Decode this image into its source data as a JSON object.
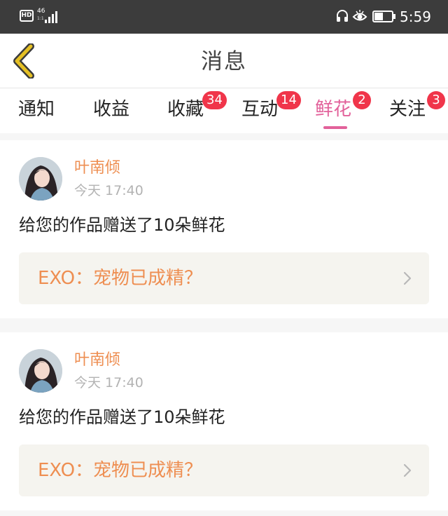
{
  "status_bar": {
    "hd": "HD",
    "network": "46",
    "network_sub": "1:1",
    "time": "5:59",
    "icons": [
      "hd-icon",
      "signal-icon",
      "headset-icon",
      "eye-icon",
      "battery-icon"
    ],
    "battery_level": 0.5
  },
  "header": {
    "title": "消息",
    "back_icon": "chevron-left-icon",
    "accent_color": "#e5c024"
  },
  "tabs": [
    {
      "label": "通知",
      "badge": ""
    },
    {
      "label": "收益",
      "badge": ""
    },
    {
      "label": "收藏",
      "badge": "34"
    },
    {
      "label": "互动",
      "badge": "14"
    },
    {
      "label": "鲜花",
      "badge": "2",
      "active": true
    },
    {
      "label": "关注",
      "badge": "3"
    }
  ],
  "colors": {
    "active_tab": "#e2619a",
    "badge": "#f0354a",
    "name": "#ee8e51",
    "link_text": "#ee8e51",
    "link_bg": "#f5f4ef"
  },
  "messages": [
    {
      "sender": "叶南倾",
      "time": "今天 17:40",
      "text": "给您的作品赠送了10朵鲜花",
      "work_title": "EXO：宠物已成精？"
    },
    {
      "sender": "叶南倾",
      "time": "今天 17:40",
      "text": "给您的作品赠送了10朵鲜花",
      "work_title": "EXO：宠物已成精？"
    }
  ]
}
